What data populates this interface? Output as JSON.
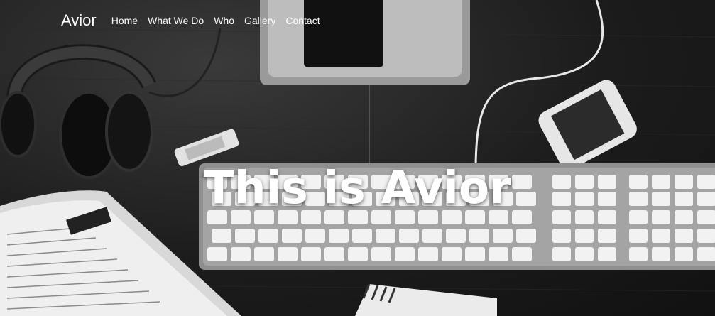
{
  "nav": {
    "brand": "Avior",
    "items": [
      "Home",
      "What We Do",
      "Who",
      "Gallery",
      "Contact"
    ]
  },
  "hero": {
    "title": "This is Avior"
  },
  "colors": {
    "text": "#ffffff",
    "background": "#1a1a1a"
  }
}
